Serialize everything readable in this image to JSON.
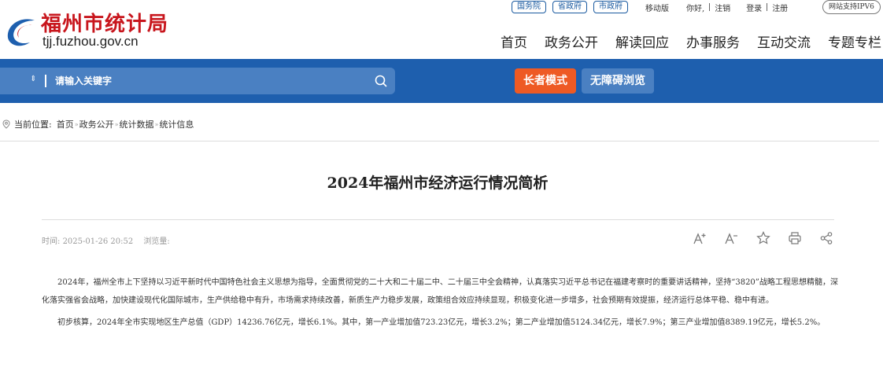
{
  "header": {
    "site_title": "福州市统计局",
    "domain": "tjj.fuzhou.gov.cn",
    "top_pills": [
      "国务院",
      "省政府",
      "市政府"
    ],
    "top_links": [
      "移动版",
      "你好,",
      "注销",
      "登录",
      "注册"
    ],
    "ipv6": "网站支持IPV6",
    "nav": [
      "首页",
      "政务公开",
      "解读回应",
      "办事服务",
      "互动交流",
      "专题专栏"
    ]
  },
  "search": {
    "selector": "⇕",
    "placeholder": "请输入关键字"
  },
  "buttons": {
    "elder": "长者模式",
    "accessible": "无障碍浏览"
  },
  "breadcrumb": {
    "label": "当前位置:",
    "items": [
      "首页",
      "政务公开",
      "统计数据",
      "统计信息"
    ]
  },
  "article": {
    "title": "2024年福州市经济运行情况简析",
    "time_label": "时间:",
    "time": "2025-01-26 20:52",
    "views_label": "浏览量:",
    "paragraphs": [
      "2024年，福州全市上下坚持以习近平新时代中国特色社会主义思想为指导，全面贯彻党的二十大和二十届二中、二十届三中全会精神，认真落实习近平总书记在福建考察时的重要讲话精神，坚持“3820”战略工程思想精髓，深化落实强省会战略，加快建设现代化国际城市，生产供给稳中有升，市场需求持续改善，新质生产力稳步发展，政策组合效应持续显现，积极变化进一步增多，社会预期有效提振，经济运行总体平稳、稳中有进。",
      "初步核算，2024年全市实现地区生产总值（GDP）14236.76亿元，增长6.1%。其中，第一产业增加值723.23亿元，增长3.2%；第二产业增加值5124.34亿元，增长7.9%；第三产业增加值8389.19亿元，增长5.2%。"
    ]
  },
  "colors": {
    "brand_red": "#c8161d",
    "band_blue": "#1e5fae",
    "elder_orange": "#ee5a24"
  }
}
